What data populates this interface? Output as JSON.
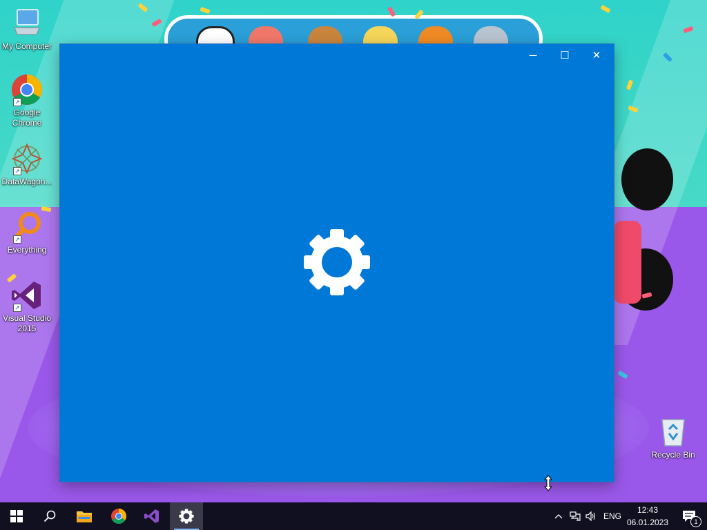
{
  "desktop": {
    "icons": [
      {
        "label": "My Computer",
        "icon": "computer-icon"
      },
      {
        "label": "Google Chrome",
        "icon": "chrome-icon"
      },
      {
        "label": "DataWagon...",
        "icon": "datawagon-icon"
      },
      {
        "label": "Everything",
        "icon": "everything-search-icon"
      },
      {
        "label": "Visual Studio 2015",
        "icon": "visual-studio-icon"
      },
      {
        "label": "Recycle Bin",
        "icon": "recycle-bin-icon"
      }
    ]
  },
  "window": {
    "background": "#0078d7",
    "splash_icon": "gear-icon",
    "controls": {
      "minimize": "─",
      "maximize": "☐",
      "close": "✕"
    }
  },
  "taskbar": {
    "background": "#101020",
    "pinned": [
      {
        "name": "start",
        "icon": "windows-logo-icon"
      },
      {
        "name": "search",
        "icon": "search-icon"
      },
      {
        "name": "file-explorer",
        "icon": "folder-icon"
      },
      {
        "name": "chrome",
        "icon": "chrome-icon"
      },
      {
        "name": "visual-studio",
        "icon": "visual-studio-icon"
      },
      {
        "name": "settings",
        "icon": "gear-icon",
        "active": true
      }
    ],
    "tray": {
      "language": "ENG",
      "time": "12:43",
      "date": "06.01.2023",
      "notification_count": "1"
    }
  }
}
